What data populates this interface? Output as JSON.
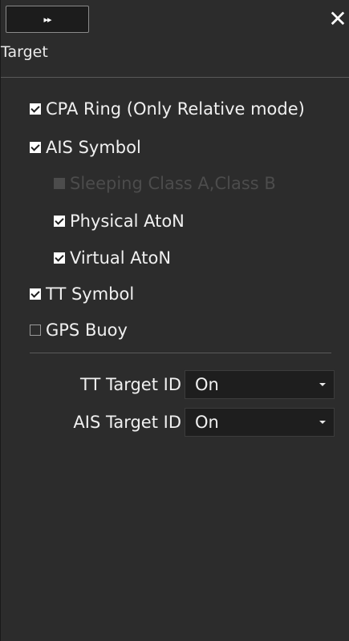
{
  "toolbar": {
    "collapse_icon": "double-chevron-right-icon",
    "collapse_glyph": "▸▸",
    "close_icon": "close-icon",
    "close_glyph": "✕"
  },
  "panel": {
    "title": "Target"
  },
  "options": [
    {
      "label": "CPA Ring (Only Relative mode)",
      "checked": true,
      "enabled": true
    },
    {
      "label": "AIS Symbol",
      "checked": true,
      "enabled": true
    },
    {
      "label": "Sleeping Class A,Class B",
      "checked": false,
      "enabled": false
    },
    {
      "label": "Physical AtoN",
      "checked": true,
      "enabled": true
    },
    {
      "label": "Virtual AtoN",
      "checked": true,
      "enabled": true
    },
    {
      "label": "TT Symbol",
      "checked": true,
      "enabled": true
    },
    {
      "label": "GPS Buoy",
      "checked": false,
      "enabled": true
    }
  ],
  "fields": [
    {
      "label": "TT Target ID",
      "value": "On"
    },
    {
      "label": "AIS Target ID",
      "value": "On"
    }
  ]
}
